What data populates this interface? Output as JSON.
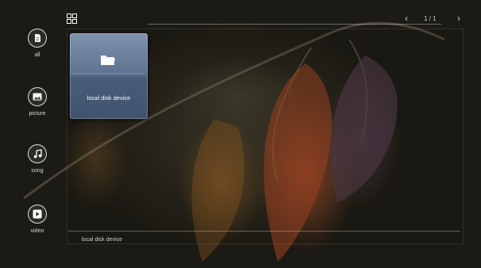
{
  "sidebar": {
    "items": [
      {
        "label": "all",
        "icon": "document-icon"
      },
      {
        "label": "picture",
        "icon": "picture-icon"
      },
      {
        "label": "song",
        "icon": "music-note-icon"
      },
      {
        "label": "video",
        "icon": "play-icon"
      }
    ]
  },
  "header": {
    "view_icon": "grid-view-icon",
    "pager": {
      "text": "1 / 1"
    }
  },
  "main": {
    "tiles": [
      {
        "label": "local disk device",
        "icon": "folder-icon"
      }
    ]
  },
  "footer": {
    "status": "local disk device"
  },
  "colors": {
    "tile_top": "#7f93ad",
    "tile_bottom": "#3f536e",
    "accent": "#ffffff"
  }
}
